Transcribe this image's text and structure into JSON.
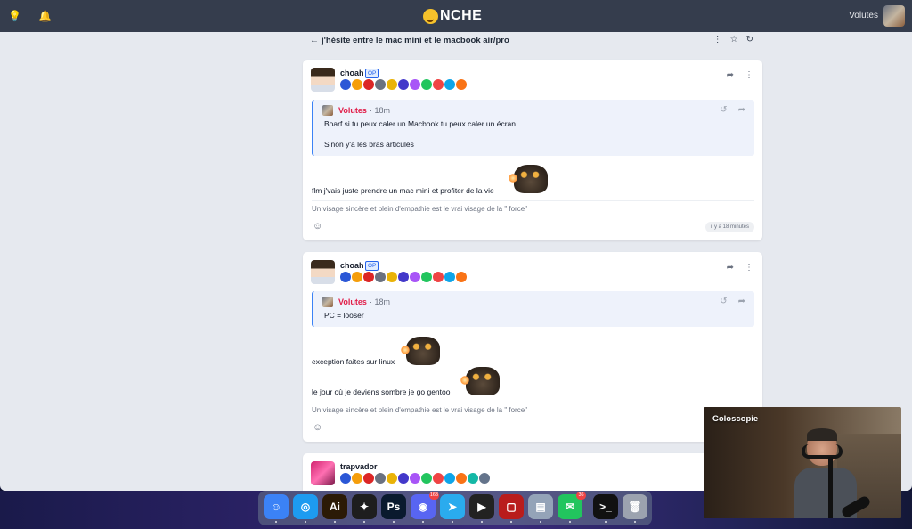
{
  "topbar": {
    "logo": "NCHE",
    "user_name": "Volutes",
    "icons": [
      "lightbulb-icon",
      "bell-icon"
    ]
  },
  "thread": {
    "title": "j'hésite entre le mac mini et le macbook air/pro"
  },
  "posts": [
    {
      "author": "choah",
      "op_label": "OP",
      "quote": {
        "author": "Volutes",
        "time": "· 18m",
        "lines": [
          "Boarf si tu peux caler un Macbook tu peux caler un écran...",
          "Sinon y'a les bras articulés"
        ]
      },
      "body": [
        "flm j'vais juste prendre un mac mini et profiter de la vie"
      ],
      "signature": "Un visage sincère et plein d'empathie est le vrai visage de la \" force\"",
      "time": "il y a 18 minutes"
    },
    {
      "author": "choah",
      "op_label": "OP",
      "quote": {
        "author": "Volutes",
        "time": "· 18m",
        "lines": [
          "PC = looser"
        ]
      },
      "body": [
        "exception faites sur linux",
        "le jour où je deviens sombre je go gentoo"
      ],
      "signature": "Un visage sincère et plein d'empathie est le vrai visage de la \" force\""
    },
    {
      "author": "trapvador"
    }
  ],
  "badge_colors": [
    "#2b57d6",
    "#f59e0b",
    "#dc2626",
    "#6b7280",
    "#eab308",
    "#4338ca",
    "#a855f7",
    "#22c55e",
    "#ef4444",
    "#0ea5e9",
    "#f97316",
    "#14b8a6",
    "#64748b"
  ],
  "dock": {
    "apps": [
      {
        "name": "finder",
        "color": "#3b82f6",
        "glyph": "☺"
      },
      {
        "name": "safari",
        "color": "#1d9bf0",
        "glyph": "◎"
      },
      {
        "name": "illustrator",
        "color": "#2b1a06",
        "glyph": "Ai"
      },
      {
        "name": "figma",
        "color": "#1e1e1e",
        "glyph": "✦"
      },
      {
        "name": "photoshop",
        "color": "#0a1a2e",
        "glyph": "Ps"
      },
      {
        "name": "discord",
        "color": "#5865f2",
        "glyph": "◉",
        "badge": "163"
      },
      {
        "name": "telegram",
        "color": "#2aabee",
        "glyph": "➤"
      },
      {
        "name": "final-cut",
        "color": "#222222",
        "glyph": "▶"
      },
      {
        "name": "screen-recorder",
        "color": "#b91c1c",
        "glyph": "▢"
      },
      {
        "name": "preview",
        "color": "#94a3b8",
        "glyph": "▤"
      },
      {
        "name": "messages",
        "color": "#22c55e",
        "glyph": "✉",
        "badge": "36"
      },
      {
        "name": "terminal",
        "color": "#111111",
        "glyph": ">_"
      },
      {
        "name": "trash",
        "color": "#9ca3af",
        "glyph": "🗑"
      }
    ]
  },
  "video": {
    "title": "Coloscopie"
  }
}
